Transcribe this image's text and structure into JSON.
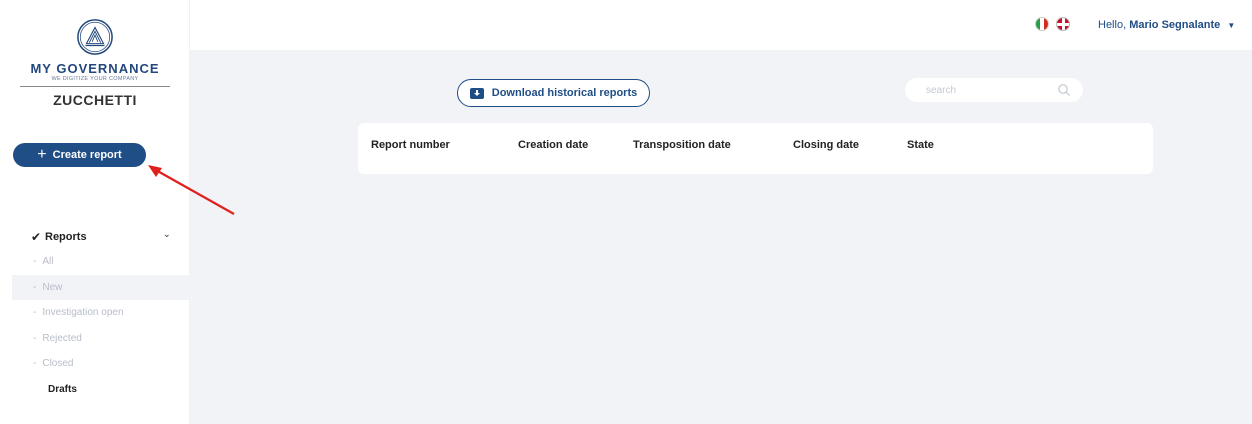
{
  "logo": {
    "brand": "MY GOVERNANCE",
    "tagline": "WE DIGITIZE YOUR COMPANY",
    "company": "ZUCCHETTI"
  },
  "sidebar": {
    "create_button": "Create report",
    "section_label": "Reports",
    "items": [
      {
        "label": "All",
        "active": false
      },
      {
        "label": "New",
        "active": true
      },
      {
        "label": "Investigation open",
        "active": false
      },
      {
        "label": "Rejected",
        "active": false
      },
      {
        "label": "Closed",
        "active": false
      }
    ],
    "drafts_label": "Drafts"
  },
  "topbar": {
    "greeting_prefix": "Hello,",
    "user_name": "Mario Segnalante",
    "languages": [
      "it-flag-icon",
      "uk-flag-icon"
    ]
  },
  "main": {
    "download_button": "Download historical reports",
    "search_placeholder": "search",
    "table": {
      "columns": [
        "Report number",
        "Creation date",
        "Transposition date",
        "Closing date",
        "State"
      ],
      "rows": []
    }
  },
  "colors": {
    "primary": "#1f4d86",
    "background": "#f2f3f7",
    "annotation_arrow": "#e0201c"
  }
}
